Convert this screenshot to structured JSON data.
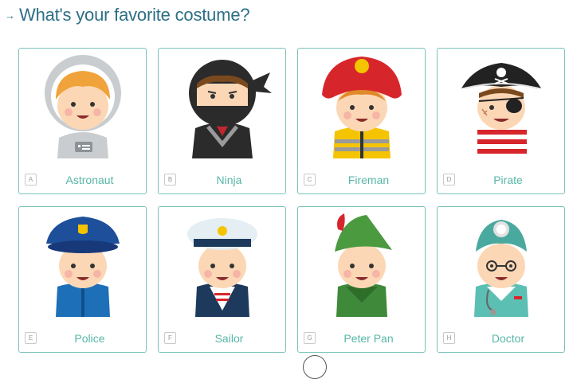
{
  "question": {
    "arrow_icon": "arrow-right-icon",
    "text": "What's your favorite costume?"
  },
  "options": [
    {
      "key": "A",
      "label": "Astronaut"
    },
    {
      "key": "B",
      "label": "Ninja"
    },
    {
      "key": "C",
      "label": "Fireman"
    },
    {
      "key": "D",
      "label": "Pirate"
    },
    {
      "key": "E",
      "label": "Police"
    },
    {
      "key": "F",
      "label": "Sailor"
    },
    {
      "key": "G",
      "label": "Peter Pan"
    },
    {
      "key": "H",
      "label": "Doctor"
    }
  ],
  "colors": {
    "question_text": "#2d6f86",
    "card_border": "#78c2ba",
    "label_text": "#58b6a8"
  }
}
